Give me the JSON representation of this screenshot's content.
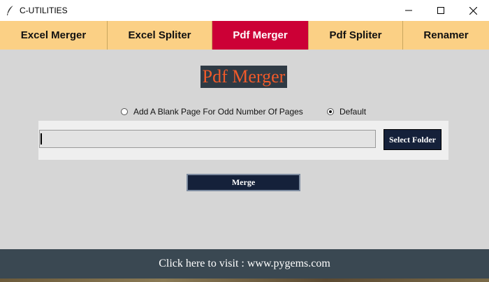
{
  "window": {
    "title": "C-UTILITIES"
  },
  "tabs": [
    {
      "label": "Excel Merger",
      "active": false
    },
    {
      "label": "Excel Spliter",
      "active": false
    },
    {
      "label": "Pdf Merger",
      "active": true
    },
    {
      "label": "Pdf Spliter",
      "active": false
    },
    {
      "label": "Renamer",
      "active": false
    }
  ],
  "main": {
    "heading": "Pdf Merger",
    "options": [
      {
        "label": "Add A Blank Page For Odd Number Of Pages",
        "checked": false
      },
      {
        "label": "Default",
        "checked": true
      }
    ],
    "folder_path_value": "",
    "select_folder_label": "Select Folder",
    "merge_label": "Merge"
  },
  "footer": {
    "link_text": "Click here to visit : www.pygems.com"
  },
  "colors": {
    "tab_bg": "#fbd085",
    "tab_active_bg": "#cc0036",
    "heading_bg": "#2f3a44",
    "heading_text": "#f05a2a",
    "button_bg": "#15213a",
    "footer_bg": "#3a4852"
  }
}
